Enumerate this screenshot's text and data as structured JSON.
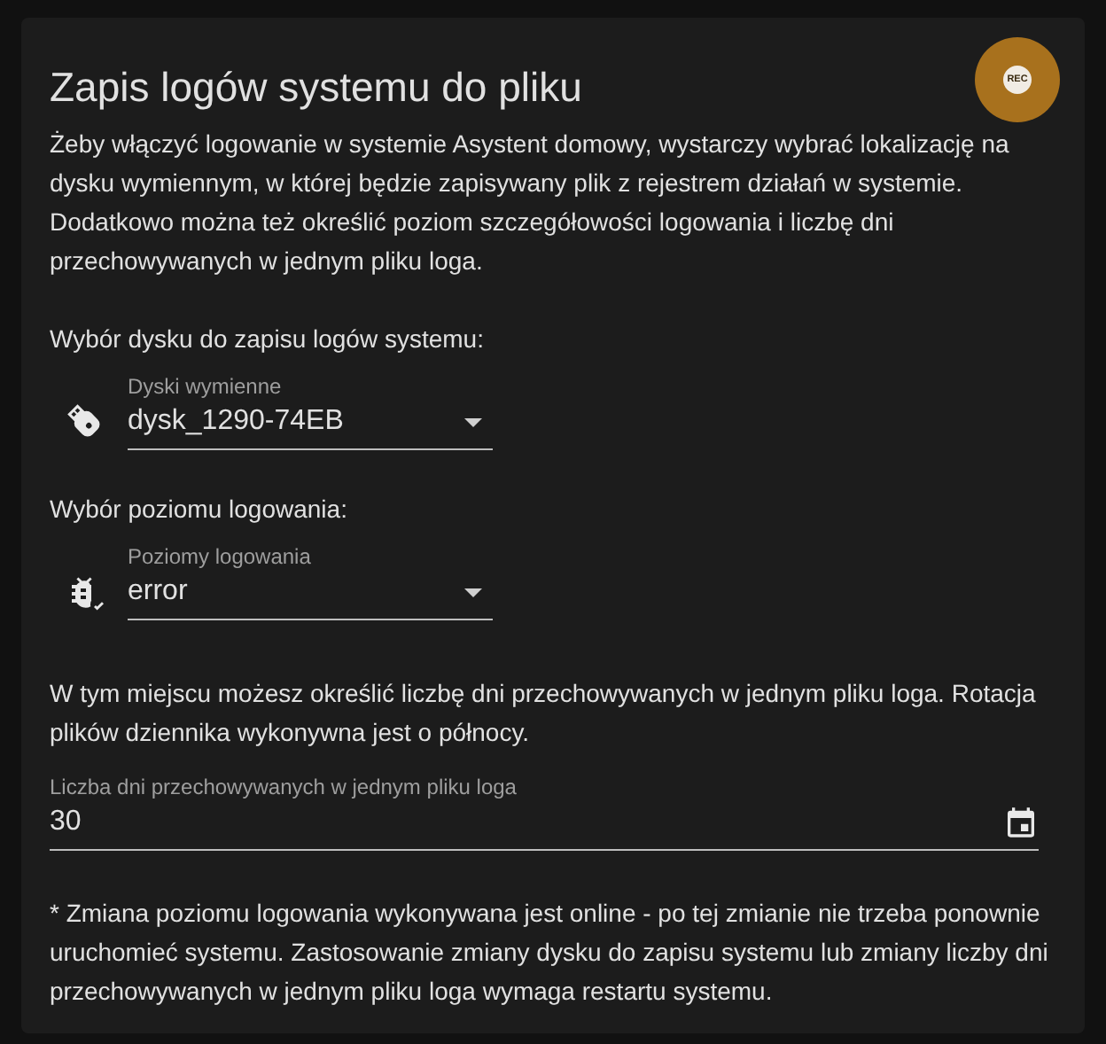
{
  "card": {
    "title": "Zapis logów systemu do pliku",
    "badge": "REC",
    "intro": "Żeby włączyć logowanie w systemie Asystent domowy, wystarczy wybrać lokalizację na dysku wymiennym, w której będzie zapisywany plik z rejestrem działań w systemie. Dodatkowo można też określić poziom szczegółowości logowania i liczbę dni przechowywanych w jednym pliku loga.",
    "sections": [
      {
        "heading": "Wybór dysku do zapisu logów systemu:",
        "kind": "usb",
        "label": "Dyski wymienne",
        "value": "dysk_1290-74EB"
      },
      {
        "heading": "Wybór poziomu logowania:",
        "kind": "bug",
        "label": "Poziomy logowania",
        "value": "error"
      }
    ],
    "retention_text": "W tym miejscu możesz określić liczbę dni przechowywanych w jednym pliku loga. Rotacja plików dziennika wykonywna jest o północy.",
    "retention_field": {
      "label": "Liczba dni przechowywanych w jednym pliku loga",
      "value": "30"
    },
    "note": "* Zmiana poziomu logowania wykonywana jest online - po tej zmianie nie trzeba ponownie uruchomieć systemu. Zastosowanie zmiany dysku do zapisu systemu lub zmiany liczby dni przechowywanych w jednym pliku loga wymaga restartu systemu."
  }
}
